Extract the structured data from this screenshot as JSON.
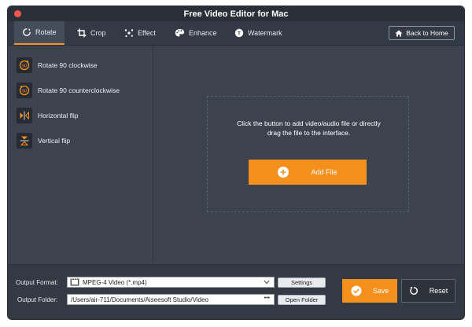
{
  "window": {
    "title": "Free Video Editor for Mac"
  },
  "tabs": [
    {
      "label": "Rotate",
      "icon": "rotate-icon",
      "active": true
    },
    {
      "label": "Crop",
      "icon": "crop-icon"
    },
    {
      "label": "Effect",
      "icon": "effect-icon"
    },
    {
      "label": "Enhance",
      "icon": "enhance-icon"
    },
    {
      "label": "Watermark",
      "icon": "watermark-icon"
    }
  ],
  "back_button": {
    "label": "Back to Home",
    "icon": "home-icon"
  },
  "sidebar": {
    "items": [
      {
        "label": "Rotate 90 clockwise",
        "icon": "rotate-clockwise-icon",
        "icon_text": "90"
      },
      {
        "label": "Rotate 90 counterclockwise",
        "icon": "rotate-counterclockwise-icon",
        "icon_text": "90"
      },
      {
        "label": "Horizontal flip",
        "icon": "horizontal-flip-icon"
      },
      {
        "label": "Vertical flip",
        "icon": "vertical-flip-icon"
      }
    ]
  },
  "drop_area": {
    "line1": "Click the button to add video/audio file or directly",
    "line2": "drag the file to the interface.",
    "add_label": "Add File"
  },
  "bottom": {
    "output_format_label": "Output Format:",
    "format_value": "MPEG-4 Video (*.mp4)",
    "settings_label": "Settings",
    "output_folder_label": "Output Folder:",
    "folder_value": "/Users/air-711/Documents/Aiseesoft Studio/Video",
    "folder_more": "•••",
    "open_folder_label": "Open Folder",
    "save_label": "Save",
    "reset_label": "Reset"
  },
  "colors": {
    "accent": "#f5901d",
    "close": "#f2564d",
    "background": "#3c434f"
  }
}
